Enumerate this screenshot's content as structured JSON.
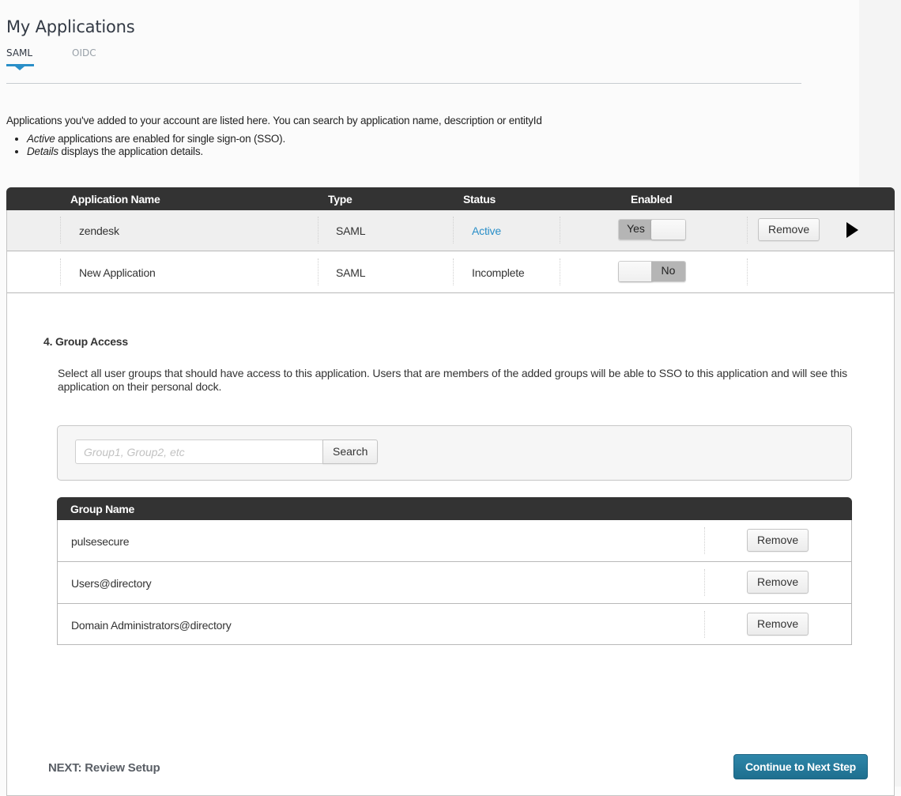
{
  "page": {
    "title": "My Applications"
  },
  "tabs": [
    {
      "label": "SAML",
      "active": true
    },
    {
      "label": "OIDC",
      "active": false
    }
  ],
  "intro": {
    "text": "Applications you've added to your account are listed here. You can search by application name, description or entityId",
    "bullets": [
      {
        "em": "Active",
        "rest": " applications are enabled for single sign-on (SSO)."
      },
      {
        "em": "Details",
        "rest": " displays the application details."
      }
    ]
  },
  "apps_table": {
    "columns": [
      "Application Name",
      "Type",
      "Status",
      "Enabled"
    ],
    "rows": [
      {
        "name": "zendesk",
        "type": "SAML",
        "status": "Active",
        "enabled": true,
        "toggle_label": "Yes",
        "action": "Remove",
        "selected": true
      },
      {
        "name": "New Application",
        "type": "SAML",
        "status": "Incomplete",
        "enabled": false,
        "toggle_label": "No",
        "action": null,
        "selected": false
      }
    ]
  },
  "group_access": {
    "title": "4. Group Access",
    "description": "Select all user groups that should have access to this application. Users that are members of the added groups will be able to SSO to this application and will see this application on their personal dock.",
    "search": {
      "placeholder": "Group1, Group2, etc",
      "value": "",
      "button_label": "Search"
    },
    "table": {
      "column": "Group Name",
      "rows": [
        {
          "name": "pulsesecure",
          "action": "Remove"
        },
        {
          "name": "Users@directory",
          "action": "Remove"
        },
        {
          "name": "Domain Administrators@directory",
          "action": "Remove"
        }
      ]
    }
  },
  "footer": {
    "next_label": "NEXT: Review Setup",
    "continue_label": "Continue to Next Step"
  },
  "colors": {
    "accent": "#2a8fc8",
    "table_header": "#333333",
    "primary_button": "#2477a0"
  }
}
